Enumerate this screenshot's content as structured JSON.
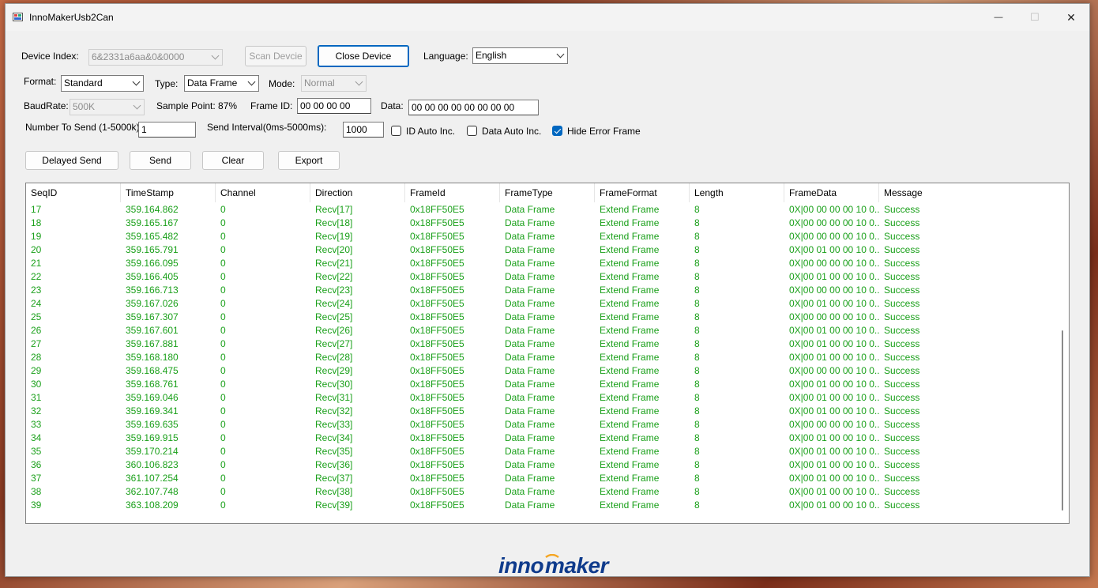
{
  "window": {
    "title": "InnoMakerUsb2Can",
    "minimize_glyph": "—",
    "maximize_glyph": "☐",
    "close_glyph": "✕"
  },
  "form": {
    "device_index_label": "Device Index:",
    "device_index_value": "6&2331a6aa&0&0000",
    "scan_button": "Scan Devcie",
    "close_device_button": "Close Device",
    "language_label": "Language:",
    "language_value": "English",
    "format_label": "Format:",
    "format_value": "Standard",
    "type_label": "Type:",
    "type_value": "Data Frame",
    "mode_label": "Mode:",
    "mode_value": "Normal",
    "baudrate_label": "BaudRate:",
    "baudrate_value": "500K",
    "sample_point_label": "Sample Point: 87%",
    "frame_id_label": "Frame ID:",
    "frame_id_value": "00 00 00 00",
    "data_label": "Data:",
    "data_value": "00 00 00 00 00 00 00 00",
    "number_to_send_label": "Number To Send (1-5000k):",
    "number_to_send_value": "1",
    "send_interval_label": "Send Interval(0ms-5000ms):",
    "send_interval_value": "1000",
    "id_auto_inc_label": "ID Auto Inc.",
    "id_auto_inc_checked": false,
    "data_auto_inc_label": "Data Auto Inc.",
    "data_auto_inc_checked": false,
    "hide_error_frame_label": "Hide Error Frame",
    "hide_error_frame_checked": true
  },
  "actions": {
    "delayed_send": "Delayed Send",
    "send": "Send",
    "clear": "Clear",
    "export": "Export"
  },
  "table": {
    "columns": [
      "SeqID",
      "TimeStamp",
      "Channel",
      "Direction",
      "FrameId",
      "FrameType",
      "FrameFormat",
      "Length",
      "FrameData",
      "Message"
    ],
    "rows": [
      [
        "17",
        "359.164.862",
        "0",
        "Recv[17]",
        "0x18FF50E5",
        "Data Frame",
        "Extend Frame",
        "8",
        "0X|00 00 00 00 10 0...",
        "Success"
      ],
      [
        "18",
        "359.165.167",
        "0",
        "Recv[18]",
        "0x18FF50E5",
        "Data Frame",
        "Extend Frame",
        "8",
        "0X|00 00 00 00 10 0...",
        "Success"
      ],
      [
        "19",
        "359.165.482",
        "0",
        "Recv[19]",
        "0x18FF50E5",
        "Data Frame",
        "Extend Frame",
        "8",
        "0X|00 00 00 00 10 0...",
        "Success"
      ],
      [
        "20",
        "359.165.791",
        "0",
        "Recv[20]",
        "0x18FF50E5",
        "Data Frame",
        "Extend Frame",
        "8",
        "0X|00 01 00 00 10 0...",
        "Success"
      ],
      [
        "21",
        "359.166.095",
        "0",
        "Recv[21]",
        "0x18FF50E5",
        "Data Frame",
        "Extend Frame",
        "8",
        "0X|00 00 00 00 10 0...",
        "Success"
      ],
      [
        "22",
        "359.166.405",
        "0",
        "Recv[22]",
        "0x18FF50E5",
        "Data Frame",
        "Extend Frame",
        "8",
        "0X|00 01 00 00 10 0...",
        "Success"
      ],
      [
        "23",
        "359.166.713",
        "0",
        "Recv[23]",
        "0x18FF50E5",
        "Data Frame",
        "Extend Frame",
        "8",
        "0X|00 00 00 00 10 0...",
        "Success"
      ],
      [
        "24",
        "359.167.026",
        "0",
        "Recv[24]",
        "0x18FF50E5",
        "Data Frame",
        "Extend Frame",
        "8",
        "0X|00 01 00 00 10 0...",
        "Success"
      ],
      [
        "25",
        "359.167.307",
        "0",
        "Recv[25]",
        "0x18FF50E5",
        "Data Frame",
        "Extend Frame",
        "8",
        "0X|00 00 00 00 10 0...",
        "Success"
      ],
      [
        "26",
        "359.167.601",
        "0",
        "Recv[26]",
        "0x18FF50E5",
        "Data Frame",
        "Extend Frame",
        "8",
        "0X|00 01 00 00 10 0...",
        "Success"
      ],
      [
        "27",
        "359.167.881",
        "0",
        "Recv[27]",
        "0x18FF50E5",
        "Data Frame",
        "Extend Frame",
        "8",
        "0X|00 01 00 00 10 0...",
        "Success"
      ],
      [
        "28",
        "359.168.180",
        "0",
        "Recv[28]",
        "0x18FF50E5",
        "Data Frame",
        "Extend Frame",
        "8",
        "0X|00 01 00 00 10 0...",
        "Success"
      ],
      [
        "29",
        "359.168.475",
        "0",
        "Recv[29]",
        "0x18FF50E5",
        "Data Frame",
        "Extend Frame",
        "8",
        "0X|00 00 00 00 10 0...",
        "Success"
      ],
      [
        "30",
        "359.168.761",
        "0",
        "Recv[30]",
        "0x18FF50E5",
        "Data Frame",
        "Extend Frame",
        "8",
        "0X|00 01 00 00 10 0...",
        "Success"
      ],
      [
        "31",
        "359.169.046",
        "0",
        "Recv[31]",
        "0x18FF50E5",
        "Data Frame",
        "Extend Frame",
        "8",
        "0X|00 01 00 00 10 0...",
        "Success"
      ],
      [
        "32",
        "359.169.341",
        "0",
        "Recv[32]",
        "0x18FF50E5",
        "Data Frame",
        "Extend Frame",
        "8",
        "0X|00 01 00 00 10 0...",
        "Success"
      ],
      [
        "33",
        "359.169.635",
        "0",
        "Recv[33]",
        "0x18FF50E5",
        "Data Frame",
        "Extend Frame",
        "8",
        "0X|00 00 00 00 10 0...",
        "Success"
      ],
      [
        "34",
        "359.169.915",
        "0",
        "Recv[34]",
        "0x18FF50E5",
        "Data Frame",
        "Extend Frame",
        "8",
        "0X|00 01 00 00 10 0...",
        "Success"
      ],
      [
        "35",
        "359.170.214",
        "0",
        "Recv[35]",
        "0x18FF50E5",
        "Data Frame",
        "Extend Frame",
        "8",
        "0X|00 01 00 00 10 0...",
        "Success"
      ],
      [
        "36",
        "360.106.823",
        "0",
        "Recv[36]",
        "0x18FF50E5",
        "Data Frame",
        "Extend Frame",
        "8",
        "0X|00 01 00 00 10 0...",
        "Success"
      ],
      [
        "37",
        "361.107.254",
        "0",
        "Recv[37]",
        "0x18FF50E5",
        "Data Frame",
        "Extend Frame",
        "8",
        "0X|00 01 00 00 10 0...",
        "Success"
      ],
      [
        "38",
        "362.107.748",
        "0",
        "Recv[38]",
        "0x18FF50E5",
        "Data Frame",
        "Extend Frame",
        "8",
        "0X|00 01 00 00 10 0...",
        "Success"
      ],
      [
        "39",
        "363.108.209",
        "0",
        "Recv[39]",
        "0x18FF50E5",
        "Data Frame",
        "Extend Frame",
        "8",
        "0X|00 01 00 00 10 0...",
        "Success"
      ]
    ]
  },
  "logo": {
    "text": "innomaker",
    "color": "#0f3b8c",
    "accent": "#f5a623"
  },
  "colors": {
    "row_text": "#1aa01a",
    "accent": "#0067c0"
  }
}
